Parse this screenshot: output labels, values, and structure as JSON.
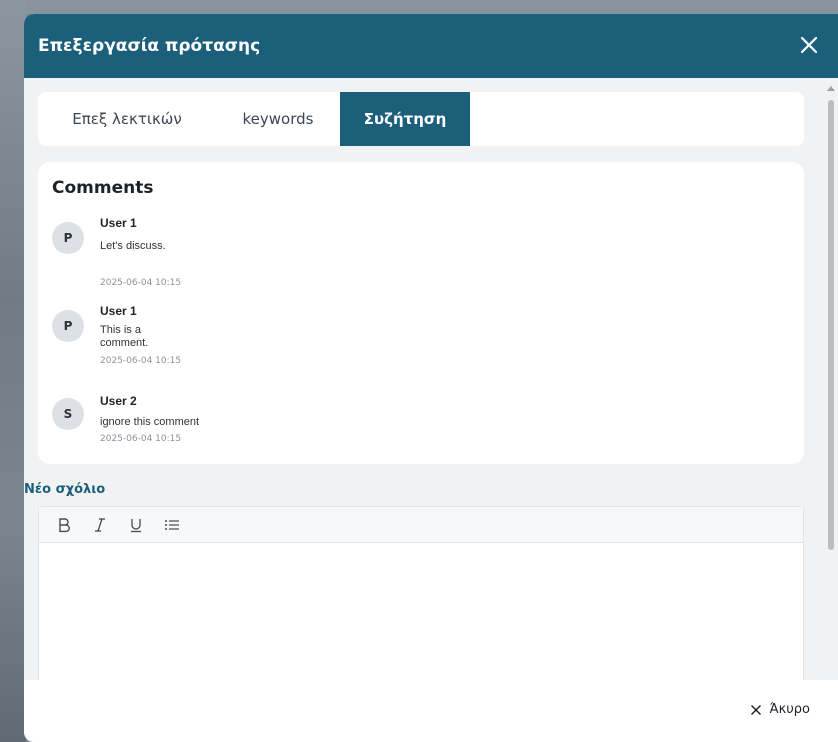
{
  "modal": {
    "title": "Επεξεργασία πρότασης"
  },
  "tabs": [
    {
      "label": "Επεξ λεκτικών",
      "active": false
    },
    {
      "label": "keywords",
      "active": false
    },
    {
      "label": "Συζήτηση",
      "active": true
    }
  ],
  "comments": {
    "title": "Comments",
    "items": [
      {
        "initial": "P",
        "user": "User 1",
        "text": "Let's discuss.",
        "time": "2025-06-04 10:15"
      },
      {
        "initial": "P",
        "user": "User 1",
        "text": "This is a\ncomment.",
        "time": "2025-06-04 10:15"
      },
      {
        "initial": "S",
        "user": "User 2",
        "text": "ignore this comment",
        "time": "2025-06-04 10:15"
      }
    ]
  },
  "new_comment": {
    "label": "Νέο σχόλιο",
    "toolbar": [
      "bold-icon",
      "italic-icon",
      "underline-icon",
      "bullet-list-icon"
    ]
  },
  "footer": {
    "cancel_label": "Άκυρο"
  },
  "colors": {
    "header": "#1b5f7b",
    "active_tab": "#1b5f7b",
    "accent_text": "#1b5f7b"
  }
}
